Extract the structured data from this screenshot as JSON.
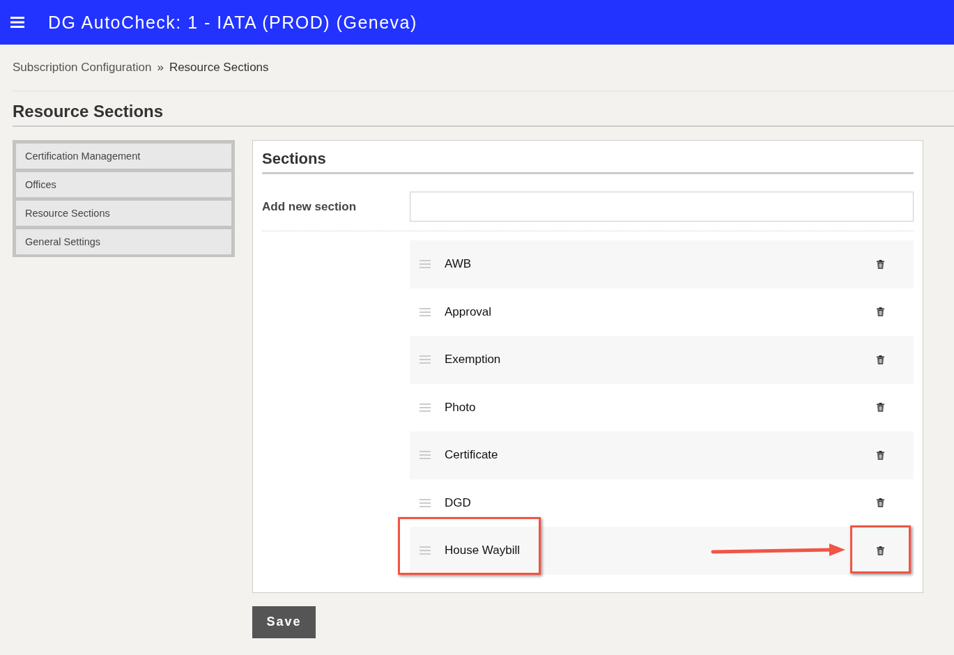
{
  "header": {
    "title": "DG AutoCheck: 1 - IATA (PROD) (Geneva)"
  },
  "breadcrumb": [
    {
      "label": "Subscription Configuration",
      "link": true
    },
    {
      "label": "Resource Sections",
      "link": false
    }
  ],
  "breadcrumb_separator": "»",
  "page_title": "Resource Sections",
  "sidebar": {
    "items": [
      {
        "label": "Certification Management"
      },
      {
        "label": "Offices"
      },
      {
        "label": "Resource Sections"
      },
      {
        "label": "General Settings"
      }
    ]
  },
  "panel": {
    "title": "Sections",
    "add_label": "Add new section",
    "sections": [
      {
        "label": "AWB",
        "highlighted": false
      },
      {
        "label": "Approval",
        "highlighted": false
      },
      {
        "label": "Exemption",
        "highlighted": false
      },
      {
        "label": "Photo",
        "highlighted": false
      },
      {
        "label": "Certificate",
        "highlighted": false
      },
      {
        "label": "DGD",
        "highlighted": false
      },
      {
        "label": "House Waybill",
        "highlighted": true
      }
    ]
  },
  "save_button": "Save"
}
